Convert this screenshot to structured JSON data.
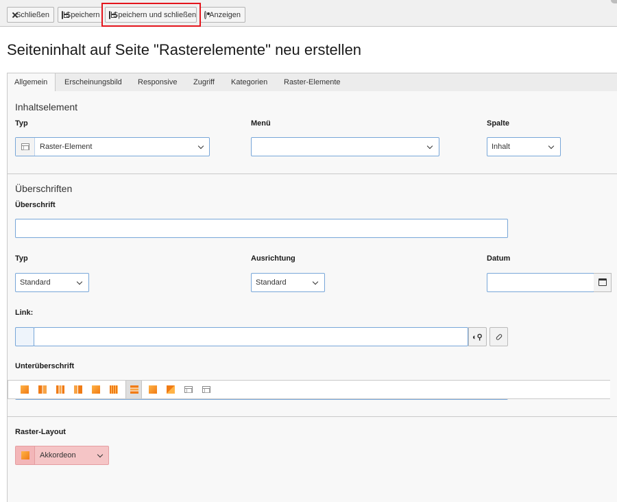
{
  "toolbar": {
    "close_label": "Schließen",
    "save_label": "Speichern",
    "save_close_label": "Speichern und schließen",
    "view_label": "Anzeigen"
  },
  "page_title": "Seiteninhalt auf Seite \"Rasterelemente\" neu erstellen",
  "tabs": [
    {
      "label": "Allgemein",
      "active": true
    },
    {
      "label": "Erscheinungsbild"
    },
    {
      "label": "Responsive"
    },
    {
      "label": "Zugriff"
    },
    {
      "label": "Kategorien"
    },
    {
      "label": "Raster-Elemente"
    }
  ],
  "content_element": {
    "heading": "Inhaltselement",
    "type_label": "Typ",
    "type_value": "Raster-Element",
    "menu_label": "Menü",
    "menu_value": "",
    "column_label": "Spalte",
    "column_value": "Inhalt"
  },
  "headers": {
    "heading": "Überschriften",
    "header_label": "Überschrift",
    "header_value": "",
    "type_label": "Typ",
    "type_value": "Standard",
    "align_label": "Ausrichtung",
    "align_value": "Standard",
    "date_label": "Datum",
    "date_value": "",
    "link_label": "Link:",
    "link_value": "",
    "subheader_label": "Unterüberschrift",
    "subheader_value": ""
  },
  "grid": {
    "layout_label": "Raster-Layout",
    "layout_value": "Akkordeon"
  },
  "colors": {
    "accent_border": "#e4141c",
    "field_border": "#77a6d8",
    "invalid_bg": "#f5c5c6"
  }
}
